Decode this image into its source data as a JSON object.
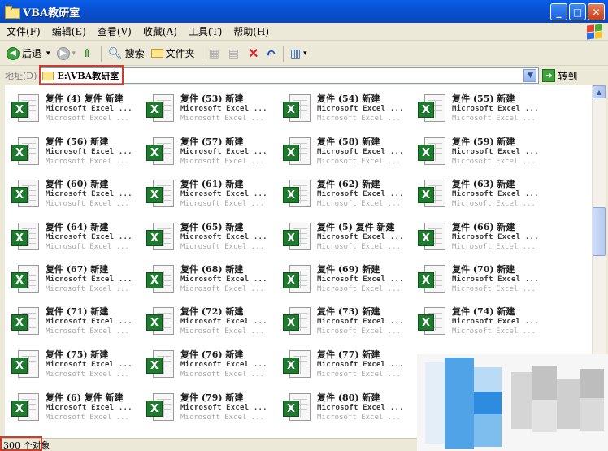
{
  "window": {
    "title": "VBA教研室",
    "buttons": [
      "_",
      "□",
      "✕"
    ]
  },
  "menu": [
    "文件(F)",
    "编辑(E)",
    "查看(V)",
    "收藏(A)",
    "工具(T)",
    "帮助(H)"
  ],
  "toolbar": {
    "back": "后退",
    "search": "搜索",
    "folders": "文件夹"
  },
  "address": {
    "label": "地址(D)",
    "path": "E:\\VBA教研室",
    "go": "转到"
  },
  "colors": {
    "titlebar": "#0850D2",
    "excel_green": "#1D7A2F",
    "highlight": "#D23A2A"
  },
  "icons": {
    "file": "excel-file-icon",
    "badge": "X"
  },
  "files": {
    "type_text": "Microsoft Excel ...",
    "size_text": "Microsoft Excel ...",
    "rows": [
      [
        "复件 (4) 复件 新建",
        "复件 (53) 新建",
        "复件 (54) 新建",
        "复件 (55) 新建"
      ],
      [
        "复件 (56) 新建",
        "复件 (57) 新建",
        "复件 (58) 新建",
        "复件 (59) 新建"
      ],
      [
        "复件 (60) 新建",
        "复件 (61) 新建",
        "复件 (62) 新建",
        "复件 (63) 新建"
      ],
      [
        "复件 (64) 新建",
        "复件 (65) 新建",
        "复件 (5) 复件 新建",
        "复件 (66) 新建"
      ],
      [
        "复件 (67) 新建",
        "复件 (68) 新建",
        "复件 (69) 新建",
        "复件 (70) 新建"
      ],
      [
        "复件 (71) 新建",
        "复件 (72) 新建",
        "复件 (73) 新建",
        "复件 (74) 新建"
      ],
      [
        "复件 (75) 新建",
        "复件 (76) 新建",
        "复件 (77) 新建",
        ""
      ],
      [
        "复件 (6) 复件 新建",
        "复件 (79) 新建",
        "复件 (80) 新建",
        ""
      ]
    ]
  },
  "status": {
    "count": "300 个对象"
  }
}
